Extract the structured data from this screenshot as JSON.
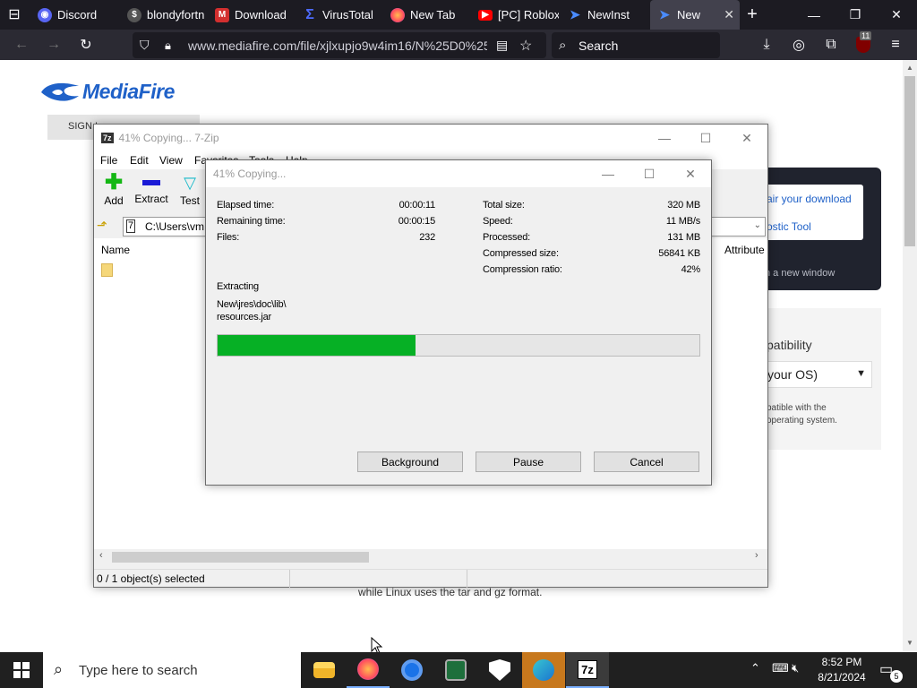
{
  "browser": {
    "tabs": [
      {
        "label": "Discord",
        "icon": "discord-icon",
        "color": "#5865f2"
      },
      {
        "label": "blondyfortn",
        "icon": "user-icon",
        "color": "#555555"
      },
      {
        "label": "Download",
        "icon": "mediafire-icon",
        "color": "#d32f2f"
      },
      {
        "label": "VirusTotal",
        "icon": "virustotal-icon",
        "color": "#394eff"
      },
      {
        "label": "New Tab",
        "icon": "firefox-icon",
        "color": "#ff7139"
      },
      {
        "label": "[PC] Roblox",
        "icon": "youtube-icon",
        "color": "#ff0000"
      },
      {
        "label": "NewInst",
        "icon": "mediafire-icon",
        "color": "#2979ff"
      },
      {
        "label": "New",
        "icon": "mediafire-icon",
        "color": "#2979ff"
      }
    ],
    "url": "www.mediafire.com/file/xjlxupjo9w4im16/N%25D0%25",
    "search_placeholder": "Search",
    "notification_badge": "11"
  },
  "mediafire": {
    "logo": "MediaFire",
    "sign_in": "SIGN I",
    "repair_download": "air your download",
    "diagnostic_tool": "ostic Tool",
    "new_window": "n a new window",
    "compatibility": "patibility",
    "os_select": "your OS)",
    "compat_text_1": "patible with the",
    "compat_text_2": "operating system.",
    "linux_text": "while Linux uses the tar and gz format."
  },
  "zip_main": {
    "title": "41% Copying... 7-Zip",
    "menu": [
      "File",
      "Edit",
      "View",
      "Favorites",
      "Tools",
      "Help"
    ],
    "toolbar": [
      {
        "label": "Add",
        "icon": "plus-icon"
      },
      {
        "label": "Extract",
        "icon": "minus-icon"
      },
      {
        "label": "Test",
        "icon": "check-icon"
      }
    ],
    "path": "C:\\Users\\vm",
    "col_name": "Name",
    "col_attributes": "Attribute",
    "status": "0 / 1 object(s) selected"
  },
  "progress_dialog": {
    "title": "41% Copying...",
    "left": [
      {
        "label": "Elapsed time:",
        "value": "00:00:11"
      },
      {
        "label": "Remaining time:",
        "value": "00:00:15"
      },
      {
        "label": "Files:",
        "value": "232"
      }
    ],
    "right": [
      {
        "label": "Total size:",
        "value": "320 MB"
      },
      {
        "label": "Speed:",
        "value": "11 MB/s"
      },
      {
        "label": "Processed:",
        "value": "131 MB"
      },
      {
        "label": "Compressed size:",
        "value": "56841 KB"
      },
      {
        "label": "Compression ratio:",
        "value": "42%"
      }
    ],
    "operation": "Extracting",
    "file_line1": "New\\jres\\doc\\lib\\",
    "file_line2": "resources.jar",
    "progress_fraction": 0.41,
    "buttons": {
      "background": "Background",
      "pause": "Pause",
      "cancel": "Cancel"
    }
  },
  "taskbar": {
    "search_placeholder": "Type here to search",
    "time": "8:52 PM",
    "date": "8/21/2024",
    "notification_count": "5"
  },
  "colors": {
    "progress_fill": "#06b025",
    "browser_dark": "#1c1b22",
    "mediafire_blue": "#1f61c8"
  }
}
